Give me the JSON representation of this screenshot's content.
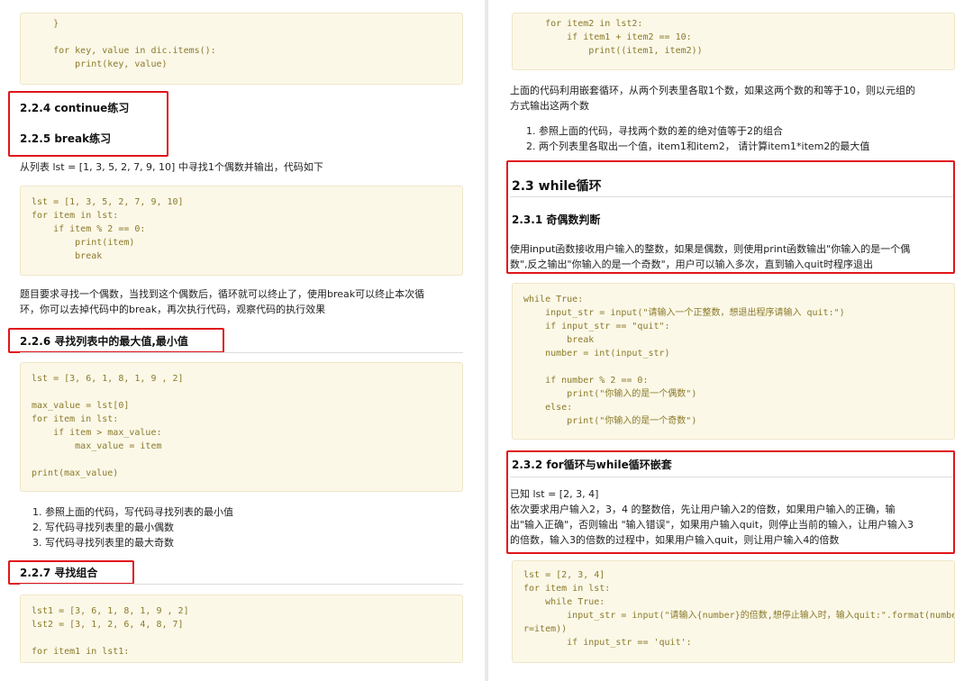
{
  "left": {
    "code_top": [
      "    }",
      "",
      "    for key, value in dic.items():",
      "        print(key, value)"
    ],
    "h_224": "2.2.4 continue练习",
    "h_225": "2.2.5 break练习",
    "p_break_intro": "从列表 lst = [1, 3, 5, 2, 7, 9, 10] 中寻找1个偶数并输出，代码如下",
    "code_break": [
      "lst = [1, 3, 5, 2, 7, 9, 10]",
      "for item in lst:",
      "    if item % 2 == 0:",
      "        print(item)",
      "        break"
    ],
    "p_break_desc1": "题目要求寻找一个偶数，当找到这个偶数后，循环就可以终止了，使用break可以终止本次循",
    "p_break_desc2": "环，你可以去掉代码中的break，再次执行代码，观察代码的执行效果",
    "h_226": "2.2.6 寻找列表中的最大值,最小值",
    "code_max": [
      "lst = [3, 6, 1, 8, 1, 9 , 2]",
      "",
      "max_value = lst[0]",
      "for item in lst:",
      "    if item > max_value:",
      "        max_value = item",
      "",
      "print(max_value)"
    ],
    "list_226": [
      "1. 参照上面的代码，写代码寻找列表的最小值",
      "2. 写代码寻找列表里的最小偶数",
      "3. 写代码寻找列表里的最大奇数"
    ],
    "h_227": "2.2.7 寻找组合",
    "code_combo": [
      "lst1 = [3, 6, 1, 8, 1, 9 , 2]",
      "lst2 = [3, 1, 2, 6, 4, 8, 7]",
      "",
      "for item1 in lst1:"
    ]
  },
  "right": {
    "code_top": [
      "    for item2 in lst2:",
      "        if item1 + item2 == 10:",
      "            print((item1, item2))"
    ],
    "p_nested1": "上面的代码利用嵌套循环，从两个列表里各取1个数，如果这两个数的和等于10，则以元组的",
    "p_nested2": "方式输出这两个数",
    "list_nested": [
      "1. 参照上面的代码，寻找两个数的差的绝对值等于2的组合",
      "2. 两个列表里各取出一个值，item1和item2， 请计算item1*item2的最大值"
    ],
    "h_23": "2.3 while循环",
    "h_231": "2.3.1 奇偶数判断",
    "p_231_1": "使用input函数接收用户输入的整数，如果是偶数，则使用print函数输出\"你输入的是一个偶",
    "p_231_2": "数\",反之输出\"你输入的是一个奇数\"，用户可以输入多次，直到输入quit时程序退出",
    "code_while": [
      "while True:",
      "    input_str = input(\"请输入一个正整数，想退出程序请输入 quit:\")",
      "    if input_str == \"quit\":",
      "        break",
      "    number = int(input_str)",
      "",
      "    if number % 2 == 0:",
      "        print(\"你输入的是一个偶数\")",
      "    else:",
      "        print(\"你输入的是一个奇数\")"
    ],
    "h_232": "2.3.2 for循环与while循环嵌套",
    "p_232_0": "已知 lst = [2, 3, 4]",
    "p_232_1": "依次要求用户输入2，3，4 的整数倍，先让用户输入2的倍数，如果用户输入的正确，输",
    "p_232_2": "出\"输入正确\"，否则输出 \"输入错误\"，如果用户输入quit，则停止当前的输入，让用户输入3",
    "p_232_3": "的倍数，输入3的倍数的过程中，如果用户输入quit，则让用户输入4的倍数",
    "code_final": [
      "lst = [2, 3, 4]",
      "for item in lst:",
      "    while True:",
      "        input_str = input(\"请输入{number}的倍数,想停止输入时，输入quit:\".format(numbe",
      "r=item))",
      "        if input_str == 'quit':"
    ]
  }
}
